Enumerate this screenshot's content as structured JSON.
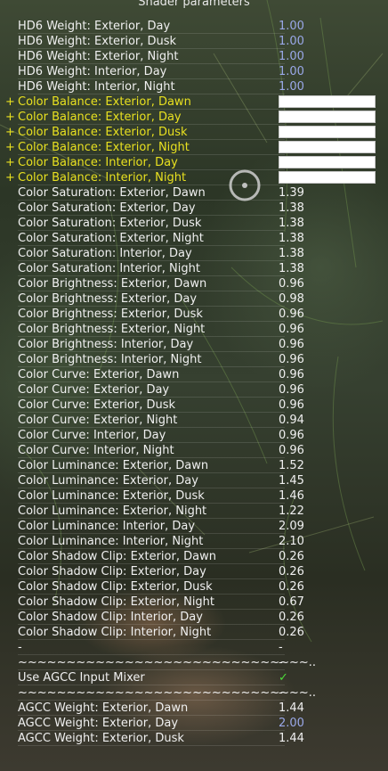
{
  "title": "Shader parameters",
  "colors": {
    "text": "#f0f0f0",
    "highlight": "#e8e020",
    "blue_value": "#9aa8e8",
    "check": "#4cdc3a"
  },
  "rows": [
    {
      "label": "HD6 Weight: Exterior, Day",
      "value": "1.00"
    },
    {
      "label": "HD6 Weight: Exterior, Dusk",
      "value": "1.00"
    },
    {
      "label": "HD6 Weight: Exterior, Night",
      "value": "1.00"
    },
    {
      "label": "HD6 Weight: Interior, Day",
      "value": "1.00"
    },
    {
      "label": "HD6 Weight: Interior, Night",
      "value": "1.00"
    },
    {
      "plus": "+",
      "label": "Color Balance: Exterior, Dawn",
      "swatch": true
    },
    {
      "plus": "+",
      "label": "Color Balance: Exterior, Day",
      "swatch": true
    },
    {
      "plus": "+",
      "label": "Color Balance: Exterior, Dusk",
      "swatch": true
    },
    {
      "plus": "+",
      "label": "Color Balance: Exterior, Night",
      "swatch": true
    },
    {
      "plus": "+",
      "label": "Color Balance: Interior, Day",
      "swatch": true
    },
    {
      "plus": "+",
      "label": "Color Balance: Interior, Night",
      "swatch": true
    },
    {
      "label": "Color Saturation: Exterior, Dawn",
      "value": "1.39"
    },
    {
      "label": "Color Saturation: Exterior, Day",
      "value": "1.38"
    },
    {
      "label": "Color Saturation: Exterior, Dusk",
      "value": "1.38"
    },
    {
      "label": "Color Saturation: Exterior, Night",
      "value": "1.38"
    },
    {
      "label": "Color Saturation: Interior, Day",
      "value": "1.38"
    },
    {
      "label": "Color Saturation: Interior, Night",
      "value": "1.38"
    },
    {
      "label": "Color Brightness: Exterior, Dawn",
      "value": "0.96"
    },
    {
      "label": "Color Brightness: Exterior, Day",
      "value": "0.98"
    },
    {
      "label": "Color Brightness: Exterior, Dusk",
      "value": "0.96"
    },
    {
      "label": "Color Brightness: Exterior, Night",
      "value": "0.96"
    },
    {
      "label": "Color Brightness: Interior, Day",
      "value": "0.96"
    },
    {
      "label": "Color Brightness: Interior, Night",
      "value": "0.96"
    },
    {
      "label": "Color Curve: Exterior, Dawn",
      "value": "0.96"
    },
    {
      "label": "Color Curve: Exterior, Day",
      "value": "0.96"
    },
    {
      "label": "Color Curve: Exterior, Dusk",
      "value": "0.96"
    },
    {
      "label": "Color Curve: Exterior, Night",
      "value": "0.94"
    },
    {
      "label": "Color Curve: Interior, Day",
      "value": "0.96"
    },
    {
      "label": "Color Curve: Interior, Night",
      "value": "0.96"
    },
    {
      "label": "Color Luminance: Exterior, Dawn",
      "value": "1.52"
    },
    {
      "label": "Color Luminance: Exterior, Day",
      "value": "1.45"
    },
    {
      "label": "Color Luminance: Exterior, Dusk",
      "value": "1.46"
    },
    {
      "label": "Color Luminance: Exterior, Night",
      "value": "1.22"
    },
    {
      "label": "Color Luminance: Interior, Day",
      "value": "2.09"
    },
    {
      "label": "Color Luminance: Interior, Night",
      "value": "2.10"
    },
    {
      "label": "Color Shadow Clip: Exterior, Dawn",
      "value": "0.26"
    },
    {
      "label": "Color Shadow Clip: Exterior, Day",
      "value": "0.26"
    },
    {
      "label": "Color Shadow Clip: Exterior, Dusk",
      "value": "0.26"
    },
    {
      "label": "Color Shadow Clip: Exterior, Night",
      "value": "0.67"
    },
    {
      "label": "Color Shadow Clip: Interior, Day",
      "value": "0.26"
    },
    {
      "label": "Color Shadow Clip: Interior, Night",
      "value": "0.26"
    },
    {
      "label": "-",
      "value": "-"
    },
    {
      "label": "~~~~~~~~~~~~~~~~~~~~~~~~~~~~~~..",
      "value": "-"
    },
    {
      "label": "Use AGCC Input Mixer",
      "check": "✓"
    },
    {
      "label": "~~~~~~~~~~~~~~~~~~~~~~~~~~~~~~..",
      "value": "-"
    },
    {
      "label": "AGCC Weight: Exterior, Dawn",
      "value": "1.44"
    },
    {
      "label": "AGCC Weight: Exterior, Day",
      "value": "2.00"
    },
    {
      "label": "AGCC Weight: Exterior, Dusk",
      "value": "1.44"
    }
  ]
}
